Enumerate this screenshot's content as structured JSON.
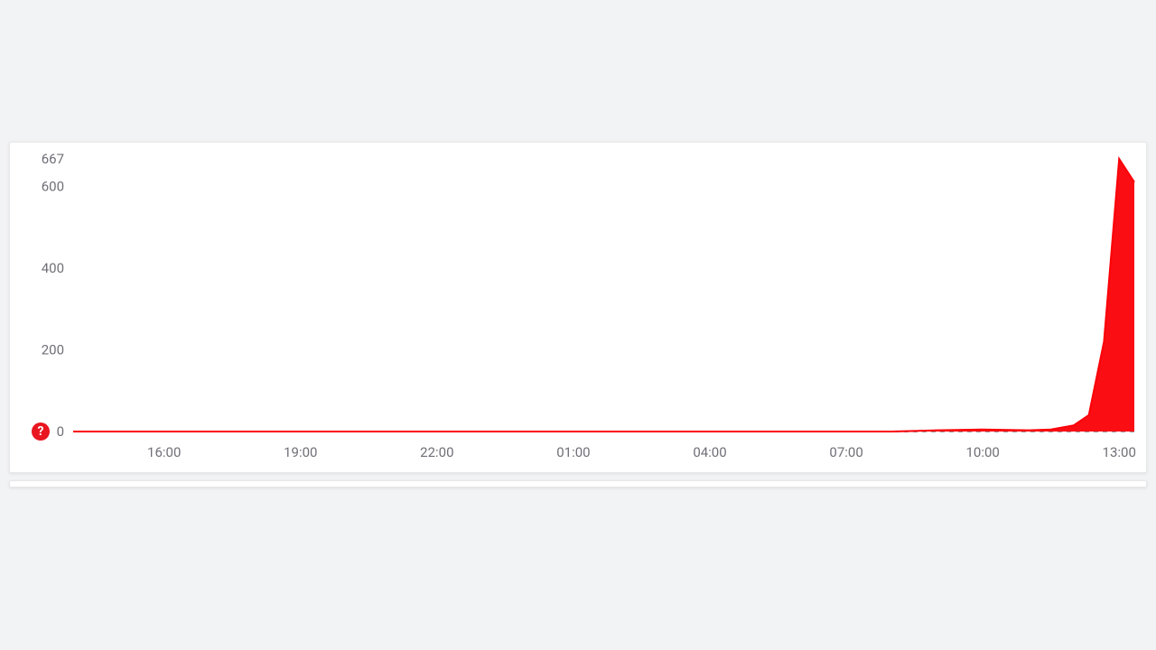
{
  "help_badge": {
    "label": "?"
  },
  "chart_data": {
    "type": "area",
    "color": "#fb0007",
    "ylim": [
      0,
      667
    ],
    "ylabel": "",
    "xlabel": "",
    "y_ticks": [
      0,
      200,
      400,
      600,
      667
    ],
    "x_tick_labels": [
      "16:00",
      "19:00",
      "22:00",
      "01:00",
      "04:00",
      "07:00",
      "10:00",
      "13:00"
    ],
    "series": [
      {
        "name": "value",
        "points": [
          {
            "t": "14:00",
            "v": 0
          },
          {
            "t": "15:00",
            "v": 0
          },
          {
            "t": "16:00",
            "v": 0
          },
          {
            "t": "17:00",
            "v": 0
          },
          {
            "t": "18:00",
            "v": 0
          },
          {
            "t": "19:00",
            "v": 0
          },
          {
            "t": "20:00",
            "v": 0
          },
          {
            "t": "21:00",
            "v": 0
          },
          {
            "t": "22:00",
            "v": 0
          },
          {
            "t": "23:00",
            "v": 0
          },
          {
            "t": "00:00",
            "v": 0
          },
          {
            "t": "01:00",
            "v": 0
          },
          {
            "t": "02:00",
            "v": 0
          },
          {
            "t": "03:00",
            "v": 0
          },
          {
            "t": "04:00",
            "v": 0
          },
          {
            "t": "05:00",
            "v": 0
          },
          {
            "t": "06:00",
            "v": 0
          },
          {
            "t": "07:00",
            "v": 0
          },
          {
            "t": "08:00",
            "v": 0
          },
          {
            "t": "09:00",
            "v": 3
          },
          {
            "t": "10:00",
            "v": 5
          },
          {
            "t": "11:00",
            "v": 3
          },
          {
            "t": "11:30",
            "v": 5
          },
          {
            "t": "12:00",
            "v": 15
          },
          {
            "t": "12:20",
            "v": 40
          },
          {
            "t": "12:40",
            "v": 220
          },
          {
            "t": "13:00",
            "v": 667
          },
          {
            "t": "13:20",
            "v": 610
          }
        ]
      }
    ]
  }
}
